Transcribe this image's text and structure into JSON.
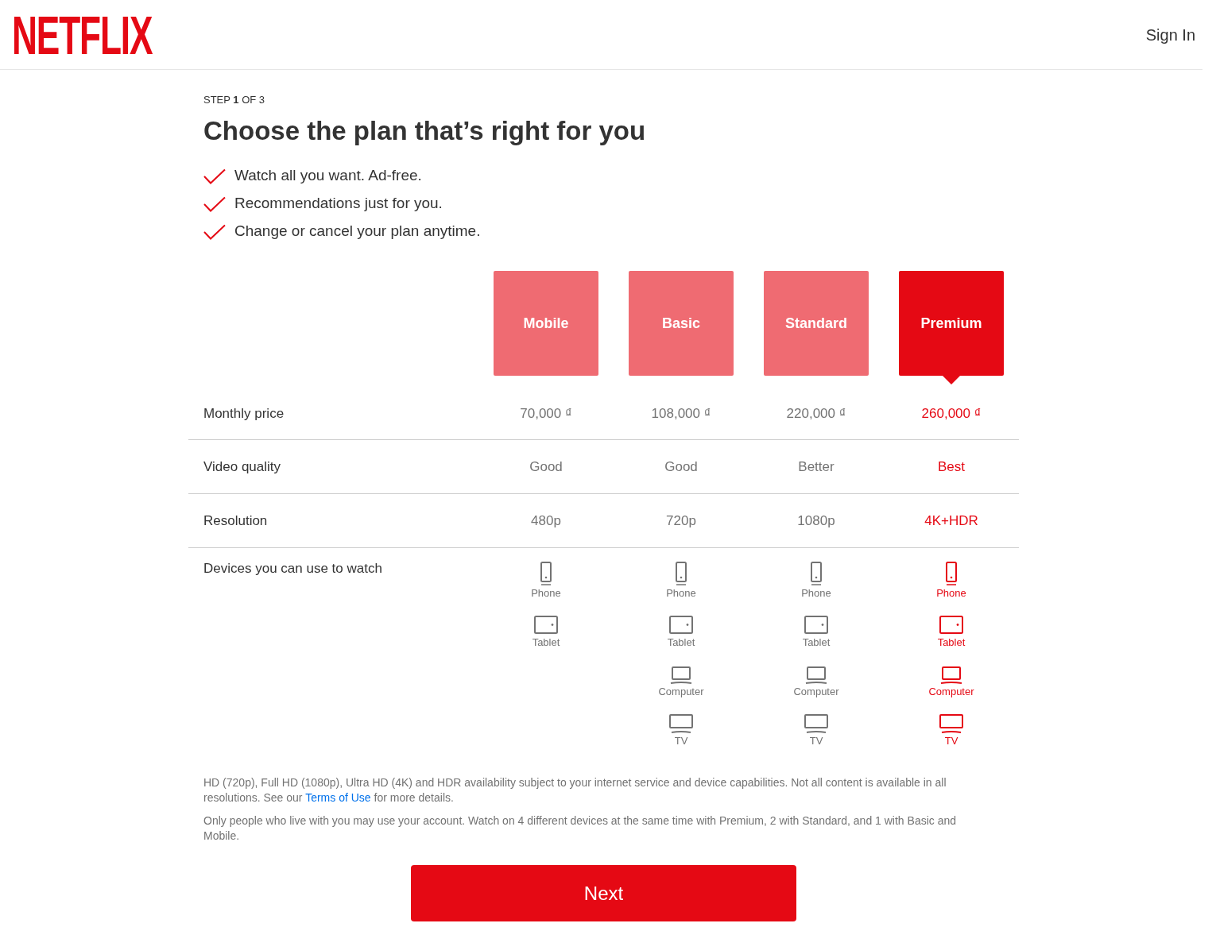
{
  "header": {
    "logo": "NETFLIX",
    "sign_in": "Sign In"
  },
  "step": "STEP **1** OF 3",
  "title": "Choose the plan that’s right for you",
  "benefits": [
    "Watch all you want. Ad-free.",
    "Recommendations just for you.",
    "Change or cancel your plan anytime."
  ],
  "plans": [
    {
      "name": "Mobile",
      "selected": false
    },
    {
      "name": "Basic",
      "selected": false
    },
    {
      "name": "Standard",
      "selected": false
    },
    {
      "name": "Premium",
      "selected": true
    }
  ],
  "rows": [
    {
      "kind": "text",
      "label": "Monthly price",
      "cells": [
        "70,000 ₫",
        "108,000 ₫",
        "220,000 ₫",
        "260,000 ₫"
      ]
    },
    {
      "kind": "text",
      "label": "Video quality",
      "cells": [
        "Good",
        "Good",
        "Better",
        "Best"
      ]
    },
    {
      "kind": "text",
      "label": "Resolution",
      "cells": [
        "480p",
        "720p",
        "1080p",
        "4K+HDR"
      ]
    },
    {
      "kind": "devices",
      "label": "Devices you can use to watch",
      "cells": [
        [
          {
            "kind": "phone",
            "label": "Phone"
          },
          {
            "kind": "tablet",
            "label": "Tablet"
          }
        ],
        [
          {
            "kind": "phone",
            "label": "Phone"
          },
          {
            "kind": "tablet",
            "label": "Tablet"
          },
          {
            "kind": "computer",
            "label": "Computer"
          },
          {
            "kind": "tv",
            "label": "TV"
          }
        ],
        [
          {
            "kind": "phone",
            "label": "Phone"
          },
          {
            "kind": "tablet",
            "label": "Tablet"
          },
          {
            "kind": "computer",
            "label": "Computer"
          },
          {
            "kind": "tv",
            "label": "TV"
          }
        ],
        [
          {
            "kind": "phone",
            "label": "Phone"
          },
          {
            "kind": "tablet",
            "label": "Tablet"
          },
          {
            "kind": "computer",
            "label": "Computer"
          },
          {
            "kind": "tv",
            "label": "TV"
          }
        ]
      ]
    }
  ],
  "notes": [
    {
      "text": "HD (720p), Full HD (1080p), Ultra HD (4K) and HDR availability subject to your internet service and device capabilities. Not all content is available in all resolutions. See our ",
      "link": "Terms of Use",
      "text_after": " for more details."
    },
    {
      "text": "Only people who live with you may use your account. Watch on 4 different devices at the same time with Premium, 2 with Standard, and 1 with Basic and Mobile."
    }
  ],
  "next_button": "Next"
}
